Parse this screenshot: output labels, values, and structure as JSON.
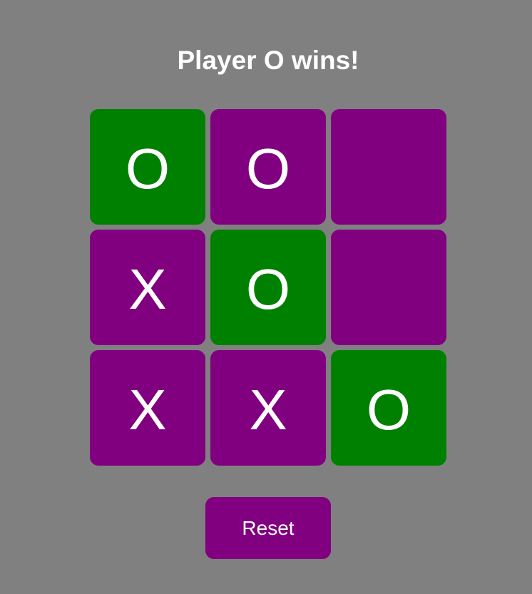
{
  "status_text": "Player O wins!",
  "colors": {
    "background": "#808080",
    "cell": "#800080",
    "winning_cell": "#008000",
    "text": "#ffffff",
    "button": "#800080"
  },
  "board": {
    "cells": [
      "O",
      "O",
      "",
      "X",
      "O",
      "",
      "X",
      "X",
      "O"
    ],
    "winning_cells": [
      0,
      4,
      8
    ],
    "winner": "O"
  },
  "reset_label": "Reset"
}
